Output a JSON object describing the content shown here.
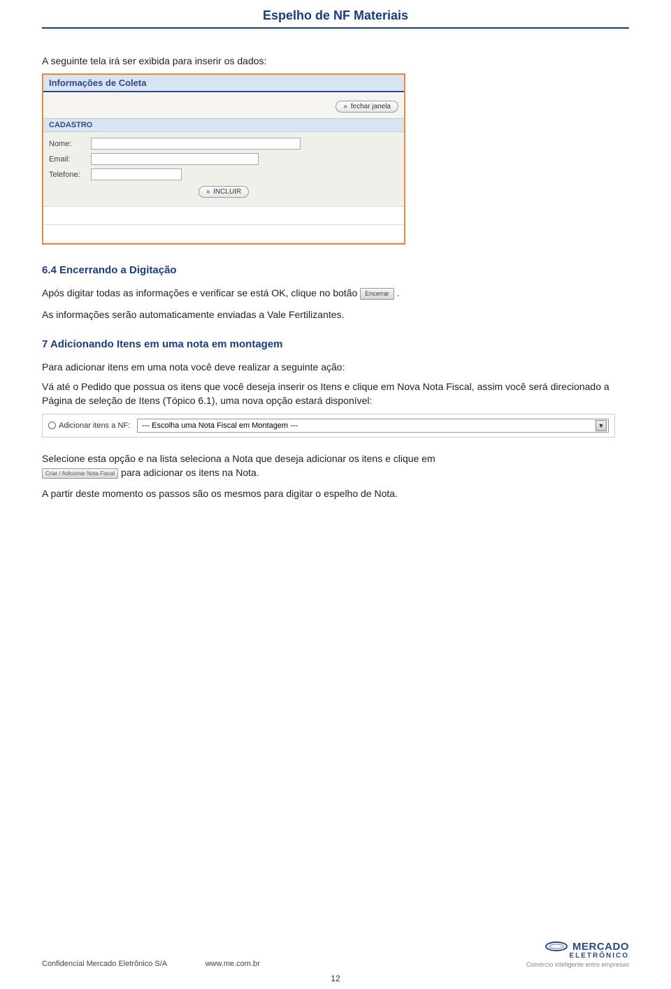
{
  "header": {
    "title": "Espelho de NF Materiais"
  },
  "intro_text": "A seguinte tela irá ser exibida para inserir os dados:",
  "coleta_panel": {
    "title": "Informações de Coleta",
    "fechar_label": "fechar janela",
    "cadastro_heading": "CADASTRO",
    "fields": {
      "nome_label": "Nome:",
      "email_label": "Email:",
      "telefone_label": "Telefone:"
    },
    "incluir_label": "INCLUIR"
  },
  "section_64": {
    "heading": "6.4 Encerrando a Digitação",
    "p1_before": "Após digitar todas as informações e verificar se está OK, clique no botão ",
    "encerrar_btn": "Encerrar",
    "p1_after": ".",
    "p2": "As informações serão automaticamente enviadas a Vale Fertilizantes."
  },
  "section_7": {
    "heading": "7 Adicionando Itens em uma nota em montagem",
    "p1": "Para adicionar itens em uma nota você deve realizar a seguinte ação:",
    "p2": "Vá até o Pedido que possua os itens que você deseja inserir os Itens e clique em Nova Nota Fiscal, assim você será direcionado a Página de seleção de Itens (Tópico 6.1), uma nova opção estará disponível:",
    "radio_label": "Adicionar itens a NF:",
    "select_text": "--- Escolha uma Nota Fiscal em Montagem ---",
    "p3_before": "Selecione esta opção e na lista seleciona a Nota que deseja adicionar os itens e clique em ",
    "criar_btn": "Criar / Adicionar Nota Fiscal",
    "p3_after": " para adicionar os itens na Nota.",
    "p4": "A partir deste momento os passos são os mesmos para digitar o espelho de Nota."
  },
  "footer": {
    "left": "Confidencial Mercado Eletrônico S/A",
    "center": "www.me.com.br",
    "page_num": "12",
    "logo_main": "MERCADO",
    "logo_sub": "ELETRÔNICO",
    "logo_tag": "Comércio inteligente entre empresas"
  }
}
